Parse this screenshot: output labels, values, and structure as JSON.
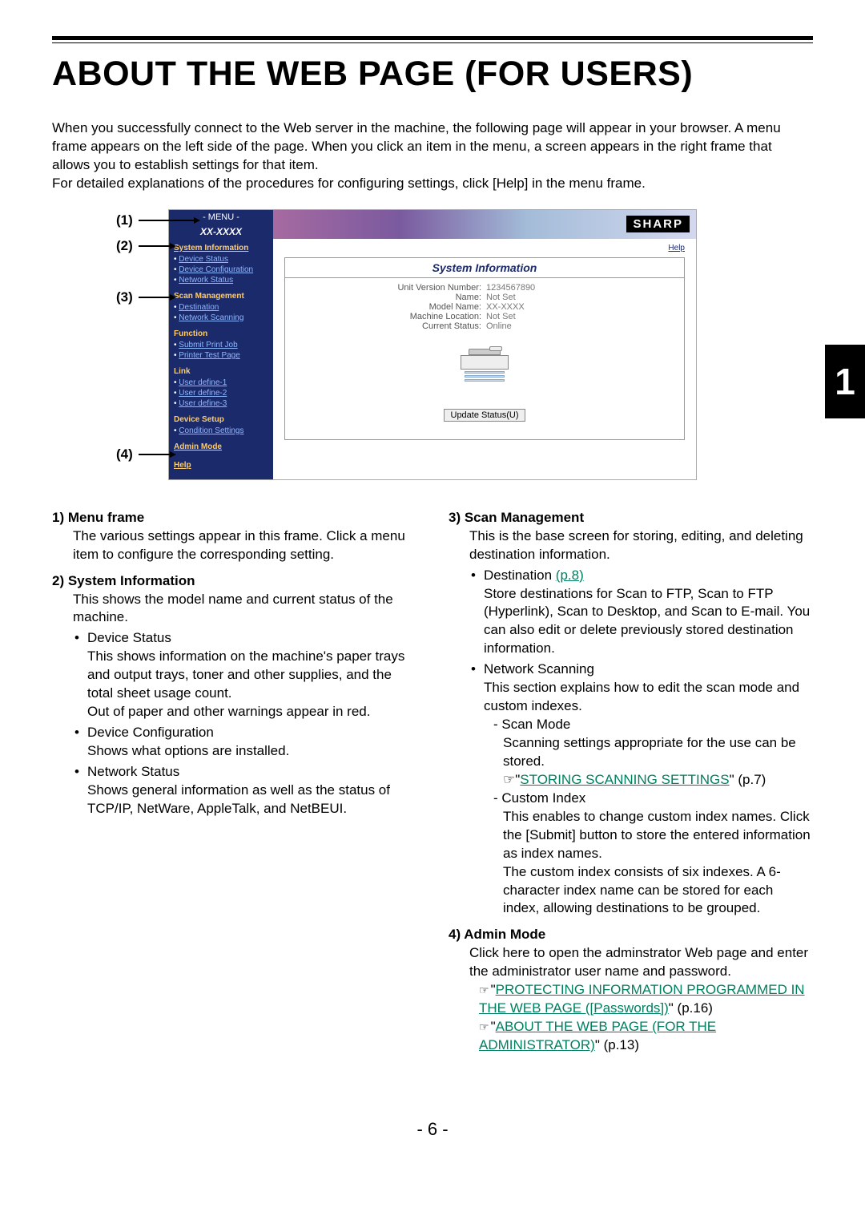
{
  "title": "ABOUT THE WEB PAGE (FOR USERS)",
  "chapter_tab": "1",
  "page_number": "- 6 -",
  "intro": "When you successfully connect to the Web server in the machine, the following page will appear in your browser. A menu frame appears on the left side of the page. When you click an item in the menu, a screen appears in the right frame that allows you to establish settings for that item.\nFor detailed explanations of the procedures for configuring settings, click [Help] in the menu frame.",
  "callouts": {
    "c1": "(1)",
    "c2": "(2)",
    "c3": "(3)",
    "c4": "(4)"
  },
  "screenshot": {
    "menu_header": "- MENU -",
    "model": "XX-XXXX",
    "help_link": "Help",
    "banner_logo": "SHARP",
    "sections": {
      "sys_info": "System Information",
      "sys_items": [
        "Device Status",
        "Device Configuration",
        "Network Status"
      ],
      "scan_mgmt": "Scan Management",
      "scan_items": [
        "Destination",
        "Network Scanning"
      ],
      "function": "Function",
      "func_items": [
        "Submit Print Job",
        "Printer Test Page"
      ],
      "link": "Link",
      "link_items": [
        "User define-1",
        "User define-2",
        "User define-3"
      ],
      "device_setup": "Device Setup",
      "setup_items": [
        "Condition Settings"
      ],
      "admin_mode": "Admin Mode",
      "help": "Help"
    },
    "right": {
      "title": "System Information",
      "rows": [
        {
          "k": "Unit Version Number:",
          "v": "1234567890"
        },
        {
          "k": "Name:",
          "v": "Not Set"
        },
        {
          "k": "Model Name:",
          "v": "XX-XXXX"
        },
        {
          "k": "Machine Location:",
          "v": "Not Set"
        },
        {
          "k": "Current Status:",
          "v": "Online"
        }
      ],
      "button": "Update Status(U)"
    }
  },
  "desc": {
    "i1_head": "1) Menu frame",
    "i1_body": "The various settings appear in this frame. Click a menu item to configure the corresponding setting.",
    "i2_head": "2) System Information",
    "i2_body": "This shows the model name and current status of the machine.",
    "i2_bullets": [
      {
        "t": "Device Status",
        "d": "This shows information on the machine's paper trays and output trays, toner and other supplies, and the total sheet usage count.\nOut of paper and other warnings appear in red."
      },
      {
        "t": "Device Configuration",
        "d": "Shows what options are installed."
      },
      {
        "t": "Network Status",
        "d": "Shows general information as well as the status of TCP/IP, NetWare, AppleTalk, and NetBEUI."
      }
    ],
    "i3_head": "3) Scan Management",
    "i3_body": "This is the base screen for storing, editing, and deleting destination information.",
    "i3_b1_label": "Destination ",
    "i3_b1_ref": "(p.8)",
    "i3_b1_d": "Store destinations for Scan to FTP, Scan to FTP (Hyperlink), Scan to Desktop, and Scan to E-mail. You can also edit or delete previously stored destination information.",
    "i3_b2_label": "Network Scanning",
    "i3_b2_d": "This section explains how to edit the scan mode and custom indexes.",
    "i3_b2_s1": "Scan Mode",
    "i3_b2_s1_d": "Scanning settings appropriate for the use can be stored.",
    "i3_b2_s1_ref_a": "\"",
    "i3_b2_s1_ref_link": "STORING SCANNING SETTINGS",
    "i3_b2_s1_ref_b": "\" (p.7)",
    "i3_b2_s2": "Custom Index",
    "i3_b2_s2_d1": "This enables to change custom index names. Click the [Submit] button to store the entered information as index names.",
    "i3_b2_s2_d2": "The custom index consists of six indexes. A 6-character index name can be stored for each index, allowing destinations to be grouped.",
    "i4_head": "4) Admin Mode",
    "i4_body": "Click here to open the adminstrator Web page and enter the administrator user name and password.",
    "i4_ref1_a": "\"",
    "i4_ref1_link": "PROTECTING INFORMATION PROGRAMMED IN THE WEB PAGE ([Passwords])",
    "i4_ref1_b": "\" (p.16)",
    "i4_ref2_a": "\"",
    "i4_ref2_link": "ABOUT THE WEB PAGE (FOR THE ADMINISTRATOR)",
    "i4_ref2_b": "\" (p.13)"
  }
}
